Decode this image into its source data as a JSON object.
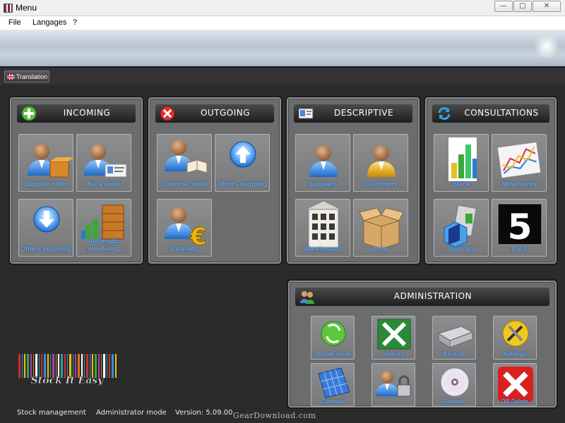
{
  "window": {
    "title": "Menu",
    "buttons": {
      "minimize": "—",
      "maximize": "□",
      "close": "✕"
    }
  },
  "menu": [
    "File",
    "Langages",
    "?"
  ],
  "toolbar": {
    "translation_label": "Translation"
  },
  "panels": {
    "incoming": {
      "title": "INCOMING",
      "icon": "plus-circle-icon",
      "tiles": [
        {
          "label": "Supplier order",
          "icon": "supplier-order-icon"
        },
        {
          "label": "Back order",
          "icon": "back-order-icon"
        },
        {
          "label": "Others incoming",
          "icon": "download-arrow-icon"
        },
        {
          "label": "Automatic reordering",
          "icon": "stacked-boxes-icon"
        }
      ]
    },
    "outgoing": {
      "title": "OUTGOING",
      "icon": "x-circle-icon",
      "tiles": [
        {
          "label": "Customer order",
          "icon": "customer-order-icon"
        },
        {
          "label": "Others outgoing",
          "icon": "upload-arrow-icon"
        },
        {
          "label": "Estimate",
          "icon": "euro-estimate-icon"
        }
      ]
    },
    "descriptive": {
      "title": "DESCRIPTIVE",
      "icon": "id-card-icon",
      "tiles": [
        {
          "label": "Suppliers",
          "icon": "supplier-person-icon"
        },
        {
          "label": "Customers",
          "icon": "customer-person-icon"
        },
        {
          "label": "Warehouses",
          "icon": "building-icon"
        },
        {
          "label": "Items",
          "icon": "cardboard-box-icon"
        }
      ]
    },
    "consultations": {
      "title": "CONSULTATIONS",
      "icon": "refresh-arrows-icon",
      "tiles": [
        {
          "label": "Stock",
          "icon": "bar-chart-icon"
        },
        {
          "label": "Movements",
          "icon": "line-chart-icon"
        },
        {
          "label": "Statistics",
          "icon": "statistics-icon"
        },
        {
          "label": "Top 5",
          "icon": "top5-icon"
        }
      ]
    },
    "administration": {
      "title": "ADMINISTRATION",
      "icon": "admin-people-icon",
      "tiles": [
        {
          "label": "Update stock",
          "icon": "update-stock-icon"
        },
        {
          "label": "Imports",
          "icon": "excel-icon"
        },
        {
          "label": "Back up",
          "icon": "hard-drive-icon"
        },
        {
          "label": "Settings",
          "icon": "tools-icon"
        },
        {
          "label": "Controls",
          "icon": "solar-panel-icon"
        },
        {
          "label": "",
          "icon": "user-lock-icon"
        },
        {
          "label": "Restore",
          "icon": "cd-disc-icon"
        },
        {
          "label": "DB Delete",
          "icon": "red-x-icon"
        }
      ]
    }
  },
  "logo": {
    "text": "Stock It Easy"
  },
  "status": {
    "app": "Stock management",
    "mode": "Administrator mode",
    "version": "Version: 5.09.00"
  },
  "watermark": "GearDownload.com"
}
